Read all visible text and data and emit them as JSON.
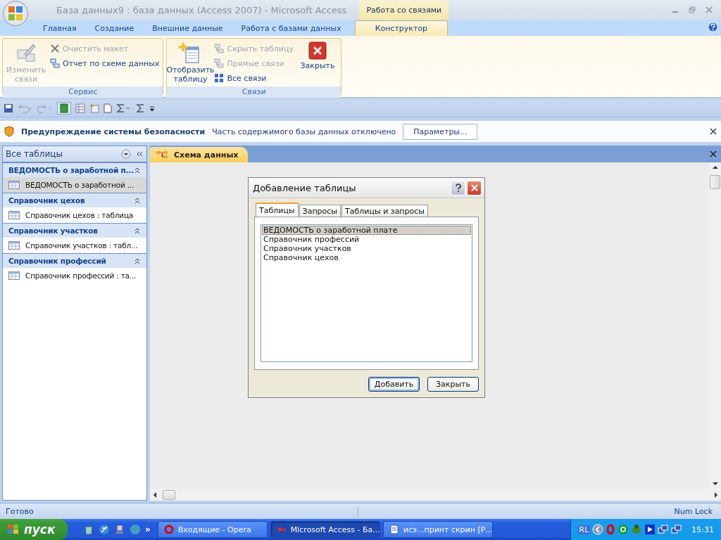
{
  "window": {
    "title": "База данных9 : база данных (Access 2007)  -  Microsoft Access",
    "contextual_group": "Работа со связями"
  },
  "ribbon_tabs": [
    {
      "label": "Главная",
      "selected": false
    },
    {
      "label": "Создание",
      "selected": false
    },
    {
      "label": "Внешние данные",
      "selected": false
    },
    {
      "label": "Работа с базами данных",
      "selected": false
    },
    {
      "label": "Конструктор",
      "selected": true,
      "kind": "contextual"
    }
  ],
  "ribbon_groups": [
    {
      "label": "Сервис",
      "buttons": [
        {
          "label": "Изменить связи",
          "kind": "large",
          "disabled": true
        },
        {
          "label": "Очистить макет",
          "kind": "small",
          "disabled": true
        },
        {
          "label": "Отчет по схеме данных",
          "kind": "small",
          "disabled": false
        }
      ]
    },
    {
      "label": "Связи",
      "buttons": [
        {
          "label": "Отобразить таблицу",
          "kind": "large",
          "disabled": false
        },
        {
          "label": "Скрыть таблицу",
          "kind": "small",
          "disabled": true
        },
        {
          "label": "Прямые связи",
          "kind": "small",
          "disabled": true
        },
        {
          "label": "Все связи",
          "kind": "small",
          "disabled": false
        },
        {
          "label": "Закрыть",
          "kind": "close",
          "disabled": false
        }
      ]
    }
  ],
  "message_bar": {
    "title": "Предупреждение системы безопасности",
    "text": "Часть содержимого базы данных отключено",
    "button": "Параметры..."
  },
  "nav_pane": {
    "title": "Все таблицы",
    "groups": [
      {
        "label": "ВЕДОМОСТЬ о заработной п...",
        "items": [
          {
            "label": "ВЕДОМОСТЬ о заработной ...",
            "selected": true
          }
        ]
      },
      {
        "label": "Справочник цехов",
        "items": [
          {
            "label": "Справочник цехов : таблица",
            "selected": false
          }
        ]
      },
      {
        "label": "Справочник участков",
        "items": [
          {
            "label": "Справочник участков : табл...",
            "selected": false
          }
        ]
      },
      {
        "label": "Справочник профессий",
        "items": [
          {
            "label": "Справочник профессий : та...",
            "selected": false
          }
        ]
      }
    ]
  },
  "document_tabs": [
    {
      "label": "Схема данных",
      "selected": true
    }
  ],
  "dialog": {
    "title": "Добавление таблицы",
    "tabs": [
      {
        "label": "Таблицы",
        "selected": true
      },
      {
        "label": "Запросы",
        "selected": false
      },
      {
        "label": "Таблицы и запросы",
        "selected": false
      }
    ],
    "list": [
      {
        "label": "ВЕДОМОСТЬ о заработной плате",
        "selected": true
      },
      {
        "label": "Справочник профессий",
        "selected": false
      },
      {
        "label": "Справочник участков",
        "selected": false
      },
      {
        "label": "Справочник цехов",
        "selected": false
      }
    ],
    "buttons": [
      {
        "label": "Добавить",
        "default": true
      },
      {
        "label": "Закрыть",
        "default": false
      }
    ]
  },
  "status_bar": {
    "left": "Готово",
    "right": "Num Lock"
  },
  "taskbar": {
    "start": "пуск",
    "overflow": "»",
    "tasks": [
      {
        "label": "Входящие - Opera",
        "selected": false
      },
      {
        "label": "Microsoft Access - Ба...",
        "selected": true
      },
      {
        "label": "исэ...принт скрин [Р...",
        "selected": false
      }
    ],
    "language": "RL",
    "clock": "15:31"
  }
}
